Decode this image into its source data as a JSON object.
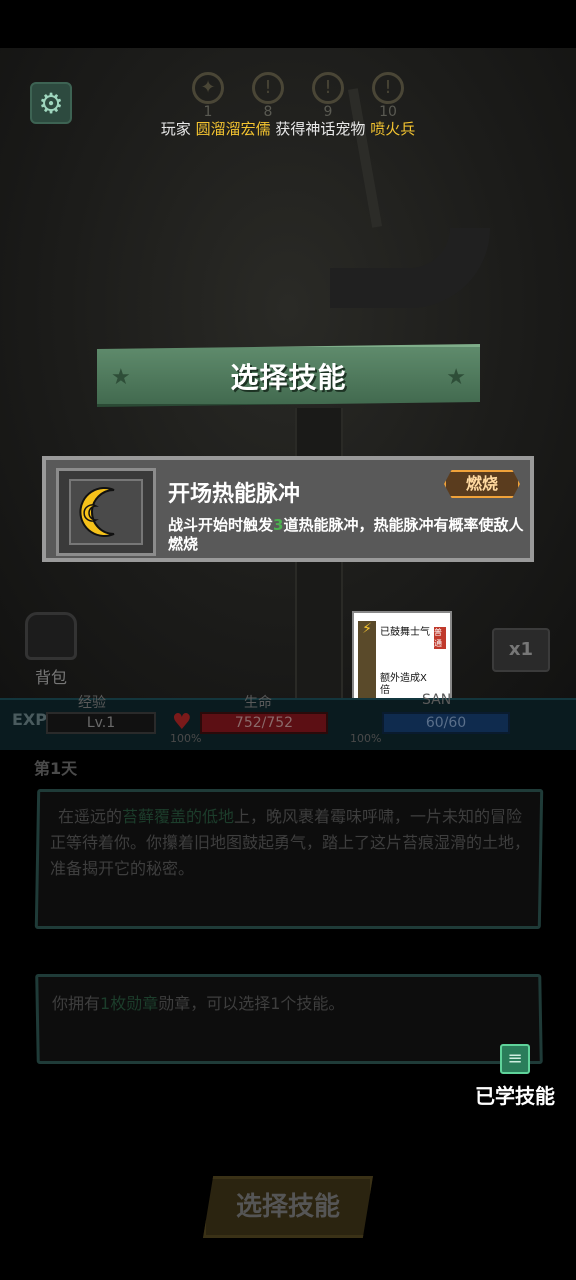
{
  "stages": [
    "1",
    "8",
    "9",
    "10"
  ],
  "broadcast": {
    "prefix": "玩家",
    "player": "圆溜溜宏儒",
    "middle": "获得神话宠物",
    "pet": "喷火兵"
  },
  "dialog": {
    "title": "选择技能",
    "skill": {
      "name": "开场热能脉冲",
      "tag": "燃烧",
      "desc_part1": "战斗开始时触发",
      "desc_num": "3",
      "desc_part2": "道热能脉冲，热能脉冲有概率使敌人燃烧"
    }
  },
  "mini_card": {
    "title": "已鼓舞士气",
    "badge": "普通",
    "sub": "额外造成X倍"
  },
  "speed_button": "x1",
  "bag_label": "背包",
  "stats": {
    "exp_label": "EXP",
    "exp_caption": "经验",
    "level": "Lv.1",
    "hp_caption": "生命",
    "hp_value": "752/752",
    "hp_pct": "100%",
    "san_caption": "SAN",
    "san_value": "60/60",
    "san_pct": "100%"
  },
  "day_label": "第1天",
  "story": {
    "part1": "在遥远的",
    "location": "苔藓覆盖的低地",
    "part2": "上，晚风裹着霉味呼啸，一片未知的冒险正等待着你。你攥着旧地图鼓起勇气，踏上了这片苔痕湿滑的土地，准备揭开它的秘密。"
  },
  "medal": {
    "part1": "你拥有",
    "medal_name": "1枚勋章",
    "part2": "勋章，可以选择1个技能。"
  },
  "learned_skills_label": "已学技能",
  "choose_button": "选择技能"
}
